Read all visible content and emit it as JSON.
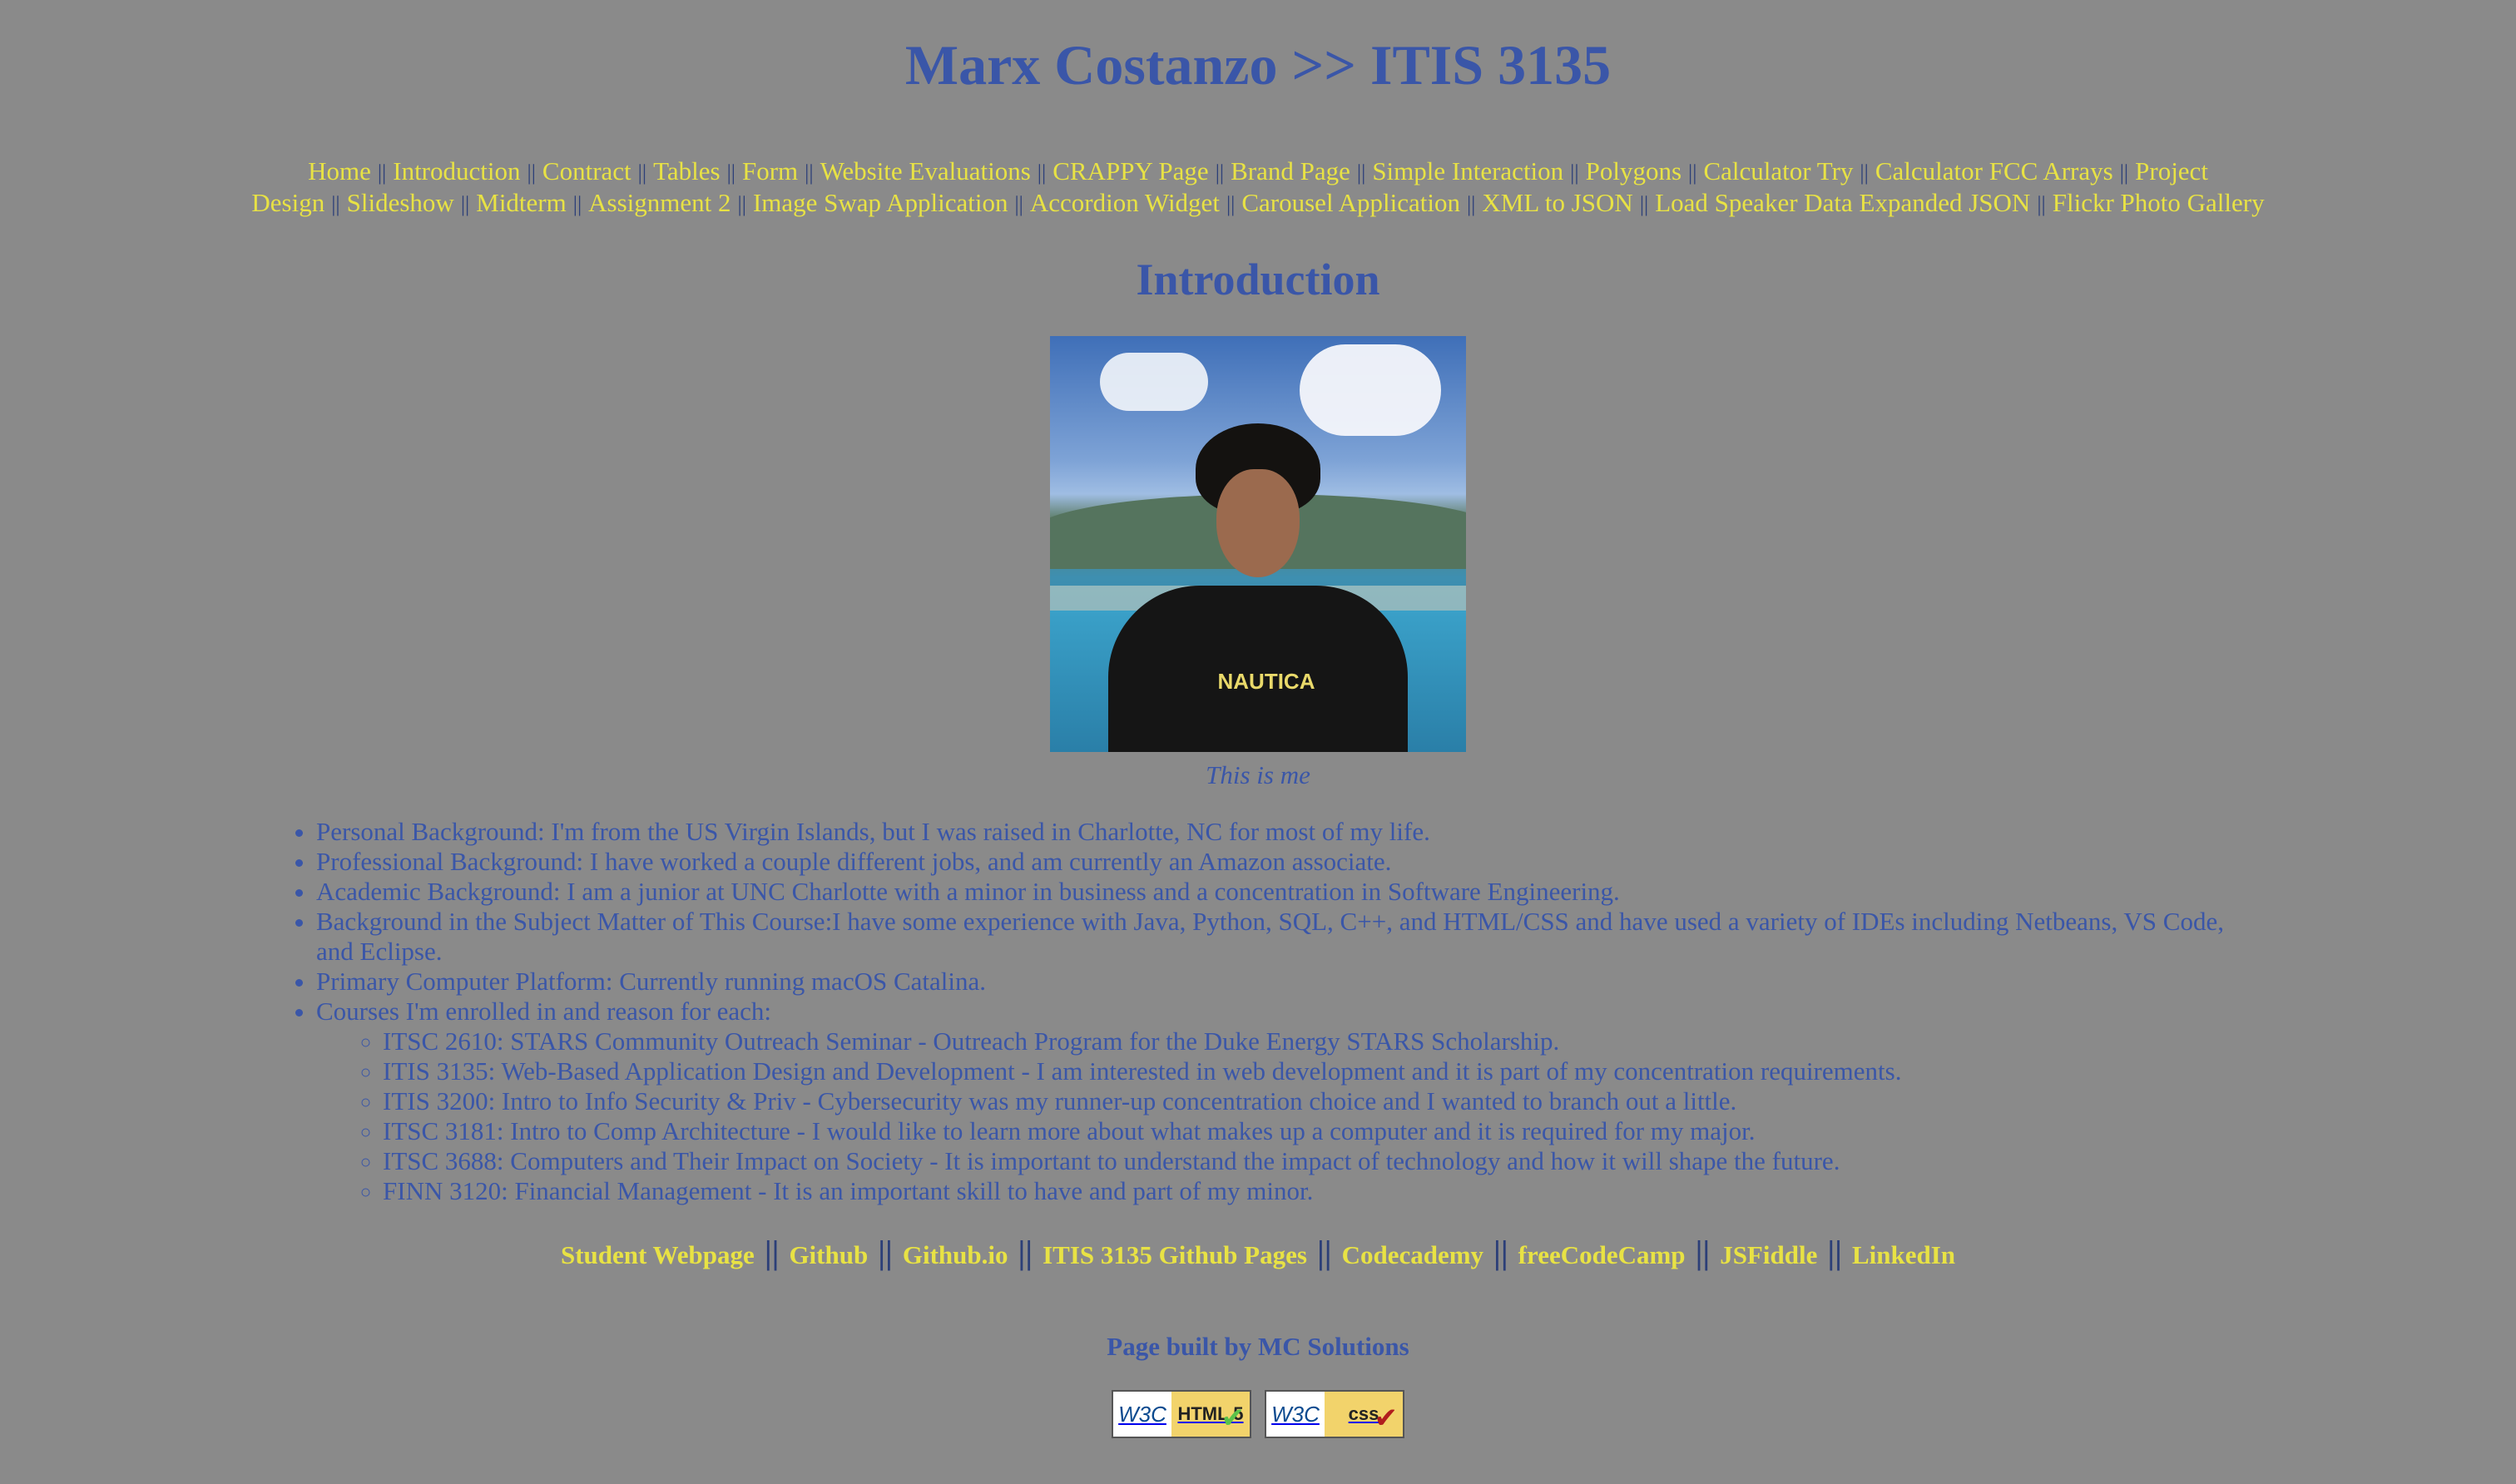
{
  "header": {
    "title": "Marx Costanzo >> ITIS 3135"
  },
  "nav": {
    "separator": "||",
    "items": [
      "Home",
      "Introduction",
      "Contract",
      "Tables",
      "Form",
      "Website Evaluations",
      "CRAPPY Page",
      "Brand Page",
      "Simple Interaction",
      "Polygons",
      "Calculator Try",
      "Calculator FCC Arrays",
      "Project Design",
      "Slideshow",
      "Midterm",
      "Assignment 2",
      "Image Swap Application",
      "Accordion Widget",
      "Carousel Application",
      "XML to JSON",
      "Load Speaker Data Expanded JSON",
      "Flickr Photo Gallery"
    ]
  },
  "main": {
    "section_title": "Introduction",
    "photo_caption": "This is me",
    "photo_shirt_text": "NAUTICA",
    "bio": [
      "Personal Background: I'm from the US Virgin Islands, but I was raised in Charlotte, NC for most of my life.",
      "Professional Background: I have worked a couple different jobs, and am currently an Amazon associate.",
      "Academic Background: I am a junior at UNC Charlotte with a minor in business and a concentration in Software Engineering.",
      "Background in the Subject Matter of This Course:I have some experience with Java, Python, SQL, C++, and HTML/CSS and have used a variety of IDEs including Netbeans, VS Code, and Eclipse.",
      "Primary Computer Platform: Currently running macOS Catalina.",
      "Courses I'm enrolled in and reason for each:"
    ],
    "courses": [
      "ITSC 2610: STARS Community Outreach Seminar - Outreach Program for the Duke Energy STARS Scholarship.",
      "ITIS 3135: Web-Based Application Design and Development - I am interested in web development and it is part of my concentration requirements.",
      "ITIS 3200: Intro to Info Security & Priv - Cybersecurity was my runner-up concentration choice and I wanted to branch out a little.",
      "ITSC 3181: Intro to Comp Architecture - I would like to learn more about what makes up a computer and it is required for my major.",
      "ITSC 3688: Computers and Their Impact on Society - It is important to understand the impact of technology and how it will shape the future.",
      "FINN 3120: Financial Management - It is an important skill to have and part of my minor."
    ]
  },
  "footer": {
    "separator": "||",
    "links": [
      "Student Webpage",
      "Github",
      "Github.io",
      "ITIS 3135 Github Pages",
      "Codecademy",
      "freeCodeCamp",
      "JSFiddle",
      "LinkedIn"
    ],
    "built_by": "Page built by MC Solutions",
    "badges": {
      "w3c_label": "W3C",
      "html_label": "HTML 5",
      "css_label": "css",
      "check_glyph": "✔"
    }
  },
  "colors": {
    "background": "#8a8a8a",
    "heading": "#3a56a8",
    "link": "#e8e244",
    "separator": "#2c3f78"
  }
}
